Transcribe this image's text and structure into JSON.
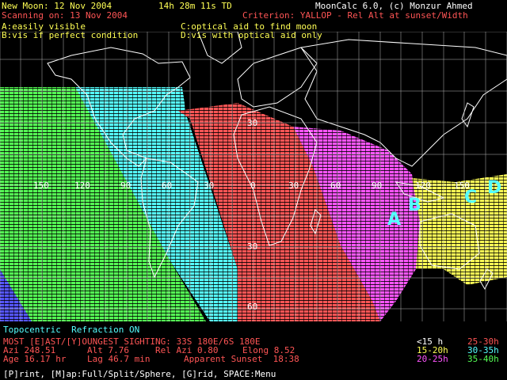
{
  "header": {
    "new_moon": "New Moon: 12 Nov 2004",
    "time": "14h 28m 11s TD",
    "app": "MoonCalc 6.0, (c) Monzur Ahmed",
    "scanning": "Scanning on: 13 Nov 2004",
    "criterion": "Criterion: YALLOP - Rel Alt at sunset/Width",
    "key_a": "A:easily visible",
    "key_b": "B:vis if perfect condition",
    "key_c": "C:optical aid to find moon",
    "key_d": "D:vis with optical aid only"
  },
  "map": {
    "lon_labels": [
      "150",
      "120",
      "90",
      "60",
      "30",
      "0",
      "30",
      "60",
      "90",
      "120",
      "150"
    ],
    "lat_labels": [
      "30",
      "30",
      "60"
    ],
    "zones": [
      {
        "letter": "A",
        "color": "#55ffff"
      },
      {
        "letter": "B",
        "color": "#55ffff"
      },
      {
        "letter": "C",
        "color": "#55ffff"
      },
      {
        "letter": "D",
        "color": "#55ffff"
      }
    ],
    "colors": {
      "green": "#55ff55",
      "cyan": "#55ffff",
      "red": "#ff5555",
      "magenta": "#ff55ff",
      "yellow": "#ffff55",
      "blue": "#5555ff",
      "grid": "#aaaaaa",
      "coast": "#ffffff"
    }
  },
  "footer": {
    "topo": "Topocentric  Refraction ON",
    "sighting": "MOST [E]AST/[Y]OUNGEST SIGHTING: 33S 180E/6S 180E",
    "azi": "Azi 248.51",
    "alt": "Alt 7.76",
    "rel_azi": "Rel Azi 0.80",
    "elong": "Elong 8.52",
    "age": "Age 16.17 hr",
    "lag": "Lag 46.7 min",
    "sunset": "Apparent Sunset  18:38",
    "menu": "[P]rint, [M]ap:Full/Split/Sphere, [G]rid, SPACE:Menu"
  },
  "legend": {
    "l1": "<15 h",
    "l2": "25-30h",
    "l3": "15-20h",
    "l4": "30-35h",
    "l5": "20-25h",
    "l6": "35-40h"
  }
}
